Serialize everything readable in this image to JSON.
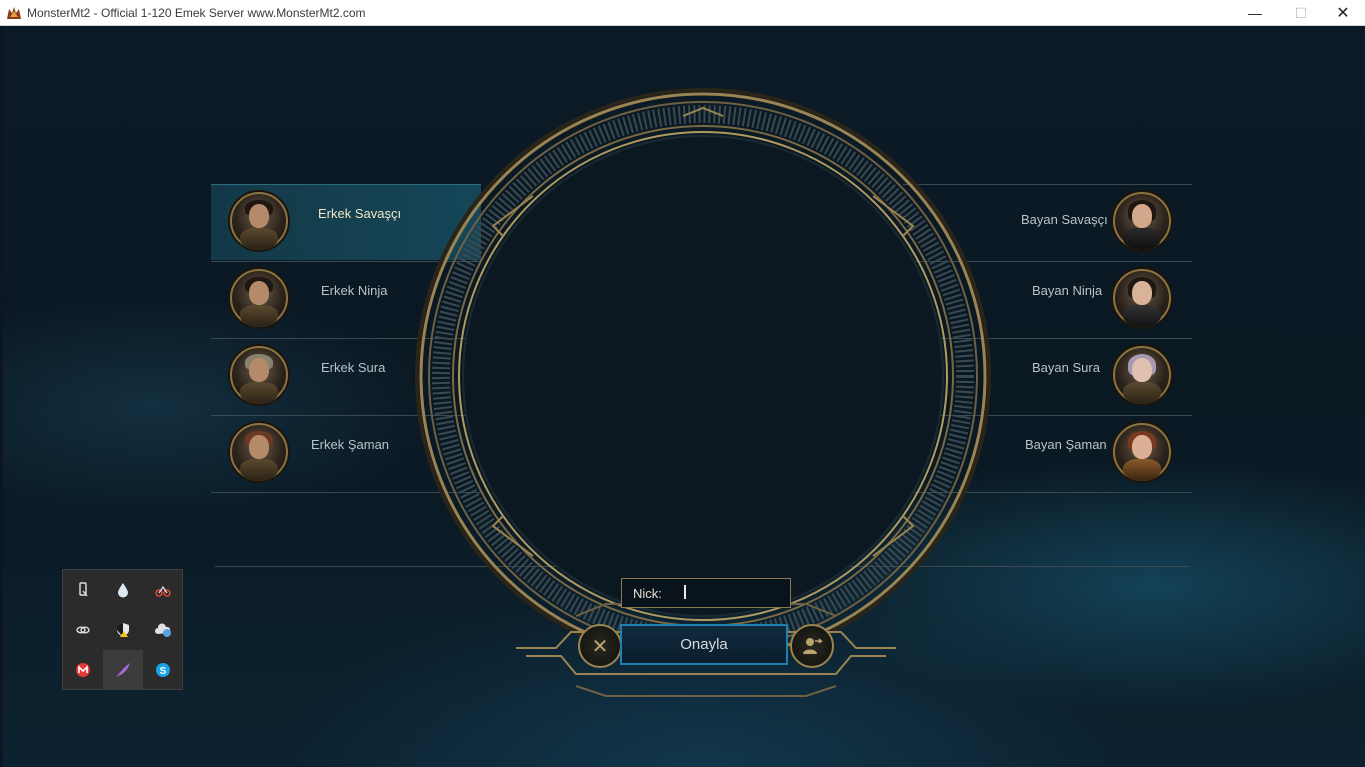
{
  "window": {
    "title": "MonsterMt2 - Official 1-120 Emek Server www.MonsterMt2.com",
    "controls": {
      "minimize": "—",
      "maximize": "☐",
      "close": "✕"
    }
  },
  "characters": {
    "male": [
      {
        "label": "Erkek Savaşçı",
        "selected": true
      },
      {
        "label": "Erkek Ninja",
        "selected": false
      },
      {
        "label": "Erkek Sura",
        "selected": false
      },
      {
        "label": "Erkek Şaman",
        "selected": false
      }
    ],
    "female": [
      {
        "label": "Bayan Savaşçı",
        "selected": false
      },
      {
        "label": "Bayan Ninja",
        "selected": false
      },
      {
        "label": "Bayan Sura",
        "selected": false
      },
      {
        "label": "Bayan Şaman",
        "selected": false
      }
    ]
  },
  "form": {
    "nick_label": "Nick:",
    "nick_value": "",
    "confirm_label": "Onayla",
    "cancel_icon": "✕"
  },
  "tray": {
    "icons": [
      {
        "name": "usb-drive-icon",
        "color": "#e0e0e0"
      },
      {
        "name": "water-drop-icon",
        "color": "#dfe8ee"
      },
      {
        "name": "bike-app-icon",
        "color": "#e04a3a"
      },
      {
        "name": "link-icon",
        "color": "#e0e0e0"
      },
      {
        "name": "security-shield-icon",
        "color": "#f0c419"
      },
      {
        "name": "cloud-sync-icon",
        "color": "#5aa0e6"
      },
      {
        "name": "antivirus-icon",
        "color": "#e23838"
      },
      {
        "name": "feather-app-icon",
        "color": "#a46cd8"
      },
      {
        "name": "skype-icon",
        "color": "#1aa3e8"
      }
    ]
  },
  "colors": {
    "accent_gold": "#9b8451",
    "accent_blue": "#1f7fb0",
    "background": "#0b1620"
  }
}
